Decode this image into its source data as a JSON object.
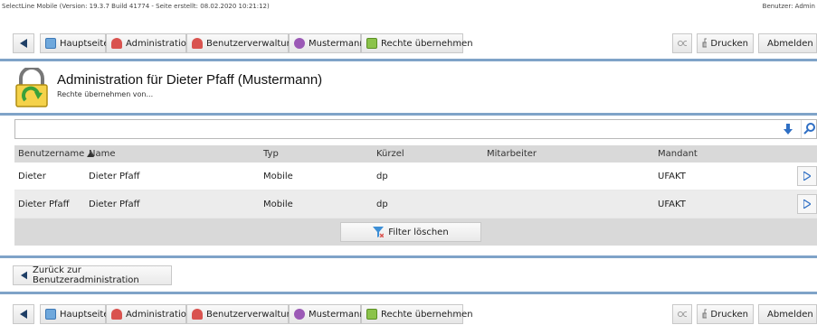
{
  "status": {
    "version_text": "SelectLine Mobile (Version: 19.3.7 Build 41774 - Seite erstellt: 08.02.2020 10:21:12)",
    "user_text": "Benutzer: Admin"
  },
  "toolbar": {
    "back_icon": "triangle-left-icon",
    "items": [
      {
        "label": "Hauptseite",
        "icon": "home-icon",
        "color": "#4a90d9"
      },
      {
        "label": "Administration",
        "icon": "admin-icon",
        "color": "#c0392b"
      },
      {
        "label": "Benutzerverwaltung",
        "icon": "users-icon",
        "color": "#c0392b"
      },
      {
        "label": "Mustermann",
        "icon": "user-icon",
        "color": "#8e44ad"
      },
      {
        "label": "Rechte übernehmen",
        "icon": "rights-icon",
        "color": "#7cb342"
      }
    ],
    "print_label": "Drucken",
    "logout_label": "Abmelden"
  },
  "page": {
    "title": "Administration für Dieter Pfaff (Mustermann)",
    "subtitle": "Rechte übernehmen von..."
  },
  "search": {
    "value": "",
    "placeholder": ""
  },
  "grid": {
    "columns": [
      "Benutzername",
      "Name",
      "Typ",
      "Kürzel",
      "Mitarbeiter",
      "Mandant"
    ],
    "sort_column": "Benutzername",
    "rows": [
      {
        "benutzername": "Dieter",
        "name": "Dieter Pfaff",
        "typ": "Mobile",
        "kuerzel": "dp",
        "mitarbeiter": "",
        "mandant": "UFAKT"
      },
      {
        "benutzername": "Dieter Pfaff",
        "name": "Dieter Pfaff",
        "typ": "Mobile",
        "kuerzel": "dp",
        "mitarbeiter": "",
        "mandant": "UFAKT"
      }
    ],
    "filter_clear_label": "Filter löschen"
  },
  "back_button": {
    "label": "Zurück zur Benutzeradministration"
  }
}
